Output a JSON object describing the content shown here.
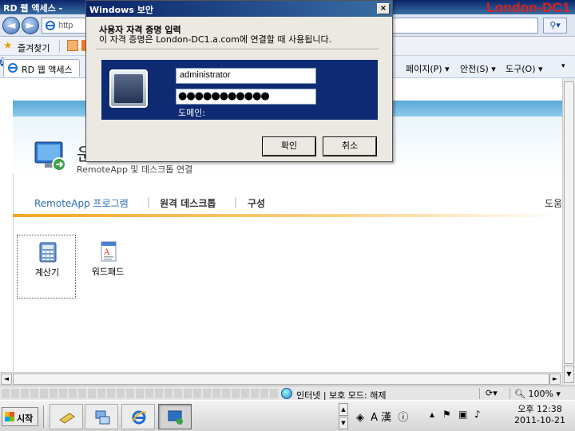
{
  "ie": {
    "window_title": "RD 웹 액세스 -",
    "watermark": "London-DC1",
    "address_url": "http",
    "favorites_label": "즐겨찾기",
    "tab_label": "RD 웹 액세스",
    "commands": {
      "page": "페이지(P) ▾",
      "safety": "안전(S) ▾",
      "tools": "도구(O) ▾",
      "help": "?"
    }
  },
  "rdweb": {
    "title_fragment": "운",
    "subtitle": "RemoteApp 및 데스크톱 연결",
    "nav": {
      "remoteapp": "RemoteApp 프로그램",
      "desktop": "원격 데스크톱",
      "config": "구성"
    },
    "help_link": "도움",
    "apps": [
      {
        "label": "계산기",
        "icon": "calculator-icon"
      },
      {
        "label": "워드패드",
        "icon": "wordpad-icon"
      }
    ]
  },
  "status": {
    "zone": "인터넷 | 보호 모드: 해제",
    "zoom": "100%"
  },
  "taskbar": {
    "start_label": "시작",
    "clock_time": "오후 12:38",
    "clock_date": "2011-10-21",
    "lang_ime": "A 漢"
  },
  "dialog": {
    "title": "Windows 보안",
    "heading": "사용자 자격 증명 입력",
    "description": "이 자격 증명은 London-DC1.a.com에 연결할 때 사용됩니다.",
    "username_value": "administrator",
    "password_mask": "●●●●●●●●●●●",
    "domain_label": "도메인:",
    "ok_label": "확인",
    "cancel_label": "취소"
  }
}
